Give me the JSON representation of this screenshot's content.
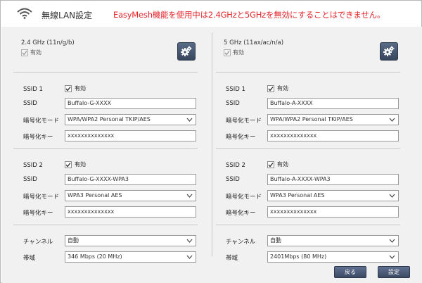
{
  "header": {
    "title": "無線LAN設定",
    "warning": "EasyMesh機能を使用中は2.4GHzと5GHzを無効にすることはできません。"
  },
  "left": {
    "band_name": "2.4 GHz (11n/g/b)",
    "enable_label": "有効",
    "ssid1": {
      "label": "SSID 1",
      "enable_label": "有効",
      "ssid_label": "SSID",
      "ssid_value": "Buffalo-G-XXXX",
      "mode_label": "暗号化モード",
      "mode_value": "WPA/WPA2 Personal TKIP/AES",
      "key_label": "暗号化キー",
      "key_value": "xxxxxxxxxxxxxx"
    },
    "ssid2": {
      "label": "SSID 2",
      "enable_label": "有効",
      "ssid_label": "SSID",
      "ssid_value": "Buffalo-G-XXXX-WPA3",
      "mode_label": "暗号化モード",
      "mode_value": "WPA3 Personal AES",
      "key_label": "暗号化キー",
      "key_value": "xxxxxxxxxxxxxx"
    },
    "channel_label": "チャンネル",
    "channel_value": "自動",
    "bandwidth_label": "帯域",
    "bandwidth_value": "346 Mbps (20 MHz)"
  },
  "right": {
    "band_name": "5 GHz (11ax/ac/n/a)",
    "enable_label": "有効",
    "ssid1": {
      "label": "SSID 1",
      "enable_label": "有効",
      "ssid_label": "SSID",
      "ssid_value": "Buffalo-A-XXXX",
      "mode_label": "暗号化モード",
      "mode_value": "WPA/WPA2 Personal TKIP/AES",
      "key_label": "暗号化キー",
      "key_value": "xxxxxxxxxxxxxx"
    },
    "ssid2": {
      "label": "SSID 2",
      "enable_label": "有効",
      "ssid_label": "SSID",
      "ssid_value": "Buffalo-A-XXXX-WPA3",
      "mode_label": "暗号化モード",
      "mode_value": "WPA3 Personal AES",
      "key_label": "暗号化キー",
      "key_value": "xxxxxxxxxxxxxx"
    },
    "channel_label": "チャンネル",
    "channel_value": "自動",
    "bandwidth_label": "帯域",
    "bandwidth_value": "2401Mbps (80 MHz)"
  },
  "buttons": {
    "back": "戻る",
    "apply": "設定"
  },
  "colors": {
    "warning": "#e4262b",
    "button": "#3b4963",
    "panel_bg": "#f1f1f1"
  },
  "icons": {
    "header": "wifi-icon",
    "band_settings": "gear-icon",
    "dropdown": "chevron-down-icon",
    "checkbox": "check-icon"
  }
}
